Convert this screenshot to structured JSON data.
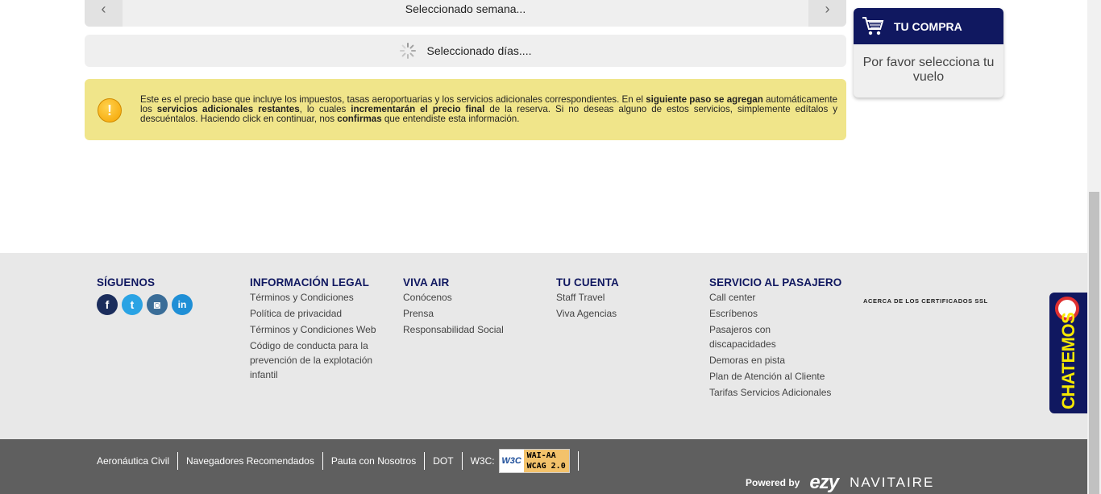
{
  "week_selector": {
    "label": "Seleccionado semana...",
    "prev_icon": "chevron-left-icon",
    "next_icon": "chevron-right-icon"
  },
  "days_selector": {
    "label": "Seleccionado días...."
  },
  "notice": {
    "p1": "Este es el precio base que incluye los impuestos, tasas aeroportuarias y los servicios adicionales correspondientes. En el ",
    "b1": "siguiente paso se agregan",
    "p2": " automáticamente los ",
    "b2": "servicios adicionales restantes",
    "p3": ", lo cuales ",
    "b3": "incrementarán el precio final",
    "p4": " de la reserva. Si no deseas alguno de estos servicios, simplemente edítalos y descuéntalos. Haciendo click en continuar, nos ",
    "b4": "confirmas",
    "p5": " que entendiste esta información."
  },
  "cart": {
    "title": "TU COMPRA",
    "message": "Por favor selecciona tu vuelo",
    "icon": "cart-icon"
  },
  "footer": {
    "follow": {
      "title": "SÍGUENOS",
      "icons": [
        "facebook-icon",
        "twitter-icon",
        "instagram-icon",
        "linkedin-icon"
      ]
    },
    "legal": {
      "title": "INFORMACIÓN LEGAL",
      "items": [
        "Términos y Condiciones",
        "Política de privacidad",
        "Términos y Condiciones Web",
        "Código de conducta para la prevención de la explotación infantil"
      ]
    },
    "vivaair": {
      "title": "VIVA AIR",
      "items": [
        "Conócenos",
        "Prensa",
        "Responsabilidad Social"
      ]
    },
    "account": {
      "title": "TU CUENTA",
      "items": [
        "Staff Travel",
        "Viva Agencias"
      ]
    },
    "service": {
      "title": "SERVICIO AL PASAJERO",
      "items": [
        "Call center",
        "Escríbenos",
        "Pasajeros con discapacidades",
        "Demoras en pista",
        "Plan de Atención al Cliente",
        "Tarifas Servicios Adicionales"
      ]
    },
    "ssl": "ACERCA DE LOS CERTIFICADOS SSL",
    "chat": "CHATEMOS"
  },
  "bottom_bar": {
    "links": [
      "Aeronáutica Civil",
      "Navegadores Recomendados",
      "Pauta con Nosotros",
      "DOT"
    ],
    "w3c_label": "W3C:",
    "w3c_logo": "W3C",
    "w3c_line1": "WAI-AA",
    "w3c_line2": "WCAG 2.0",
    "powered_by": "Powered by",
    "ezy": "ezy",
    "navitaire": "NAVITAIRE"
  },
  "colors": {
    "brand_navy": "#101860",
    "notice_bg": "#f0e58a",
    "footer_bg": "#e8e8e8",
    "bottom_bg": "#5f5f5f"
  }
}
